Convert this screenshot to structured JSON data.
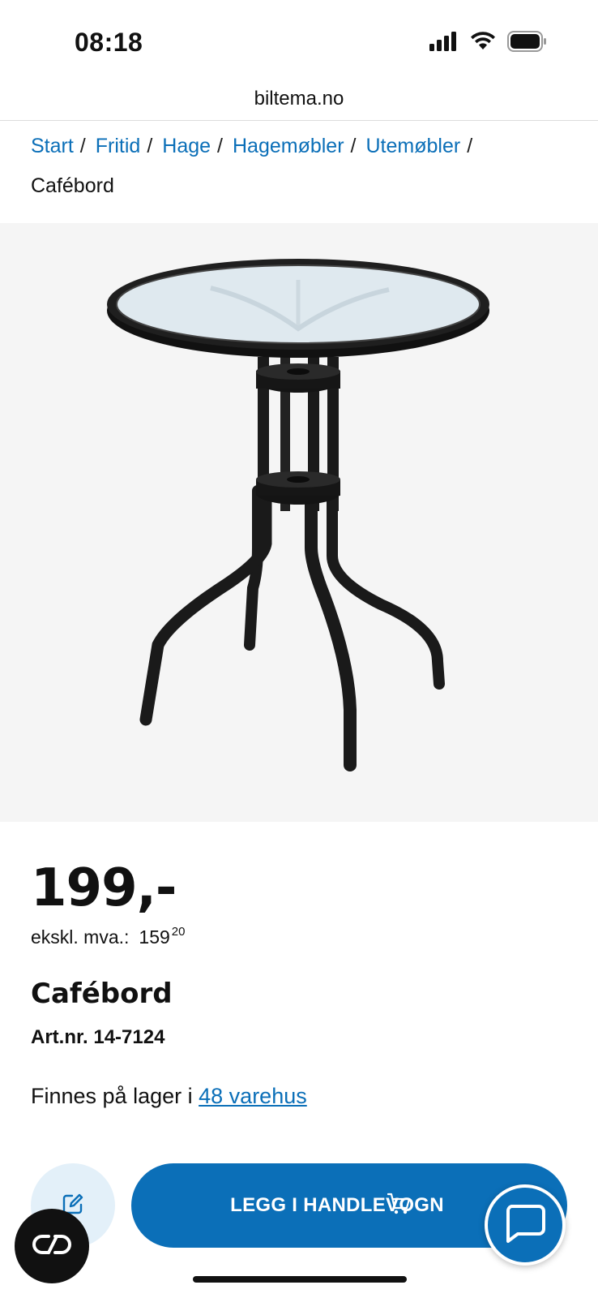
{
  "status_bar": {
    "time": "08:18"
  },
  "browser": {
    "url": "biltema.no"
  },
  "breadcrumb": {
    "items": [
      "Start",
      "Fritid",
      "Hage",
      "Hagemøbler",
      "Utemøbler"
    ],
    "separator": "/",
    "current": "Cafébord"
  },
  "product": {
    "price": "199,-",
    "vat_label": "ekskl. mva.:",
    "vat_value": "159",
    "vat_decimals": "20",
    "title": "Cafébord",
    "article_number": "Art.nr. 14-7124",
    "stock_text": "Finnes på lager i",
    "stock_link": "48 varehus"
  },
  "actions": {
    "add_to_cart_label": "LEGG I HANDLEVOGN"
  },
  "colors": {
    "accent": "#0b6fb8",
    "image_bg": "#f5f5f5",
    "note_button_bg": "#e3f0f9"
  },
  "icons": [
    "cellular-signal-icon",
    "wifi-icon",
    "battery-icon",
    "edit-note-icon",
    "cart-icon",
    "chat-icon",
    "links-icon"
  ]
}
